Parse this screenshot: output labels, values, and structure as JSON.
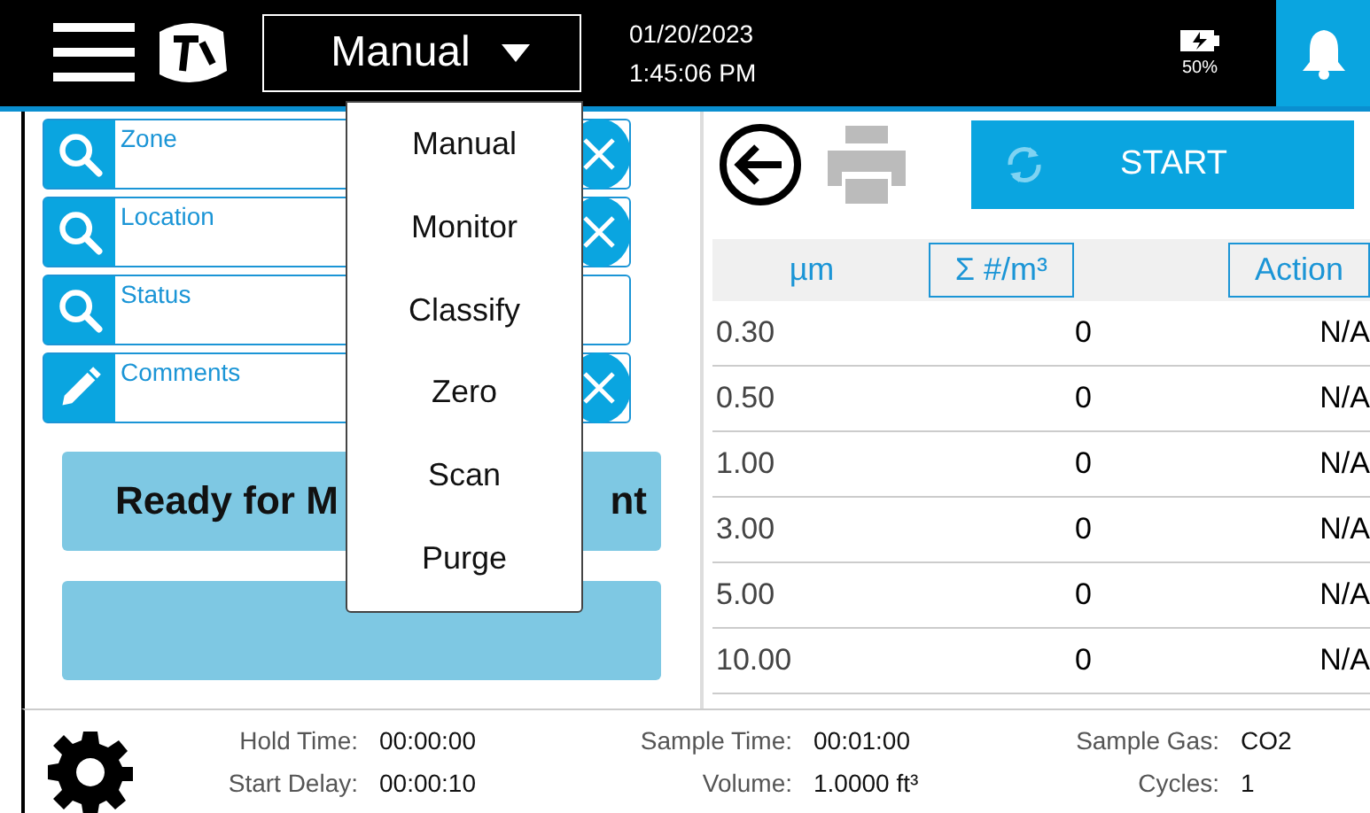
{
  "header": {
    "mode": "Manual",
    "date": "01/20/2023",
    "time": "1:45:06 PM",
    "battery": "50%"
  },
  "mode_menu": {
    "expanded": true,
    "items": [
      {
        "label": "Manual"
      },
      {
        "label": "Monitor"
      },
      {
        "label": "Classify"
      },
      {
        "label": "Zero"
      },
      {
        "label": "Scan"
      },
      {
        "label": "Purge"
      }
    ]
  },
  "fields": [
    {
      "label": "Zone",
      "kind": "search",
      "clearable": true
    },
    {
      "label": "Location",
      "kind": "search",
      "clearable": true
    },
    {
      "label": "Status",
      "kind": "search",
      "clearable": false
    },
    {
      "label": "Comments",
      "kind": "edit",
      "clearable": true
    }
  ],
  "status_panel": {
    "text_start": "Ready for M",
    "text_end": "nt"
  },
  "toolbar": {
    "print_disabled": true,
    "start_label": "START"
  },
  "table": {
    "columns": [
      {
        "label": "µm",
        "boxed": false
      },
      {
        "label": "Σ #/m³",
        "boxed": true
      },
      {
        "label": "Action",
        "boxed": true
      }
    ],
    "rows": [
      [
        "0.30",
        "0",
        "N/A"
      ],
      [
        "0.50",
        "0",
        "N/A"
      ],
      [
        "1.00",
        "0",
        "N/A"
      ],
      [
        "3.00",
        "0",
        "N/A"
      ],
      [
        "5.00",
        "0",
        "N/A"
      ],
      [
        "10.00",
        "0",
        "N/A"
      ]
    ]
  },
  "settings": [
    {
      "label": "Hold Time:",
      "value": "00:00:00"
    },
    {
      "label": "Sample Time:",
      "value": "00:01:00"
    },
    {
      "label": "Sample Gas:",
      "value": "CO2"
    },
    {
      "label": "Start Delay:",
      "value": "00:00:10"
    },
    {
      "label": "Volume:",
      "value": "1.0000 ft³"
    },
    {
      "label": "Cycles:",
      "value": "1"
    }
  ]
}
